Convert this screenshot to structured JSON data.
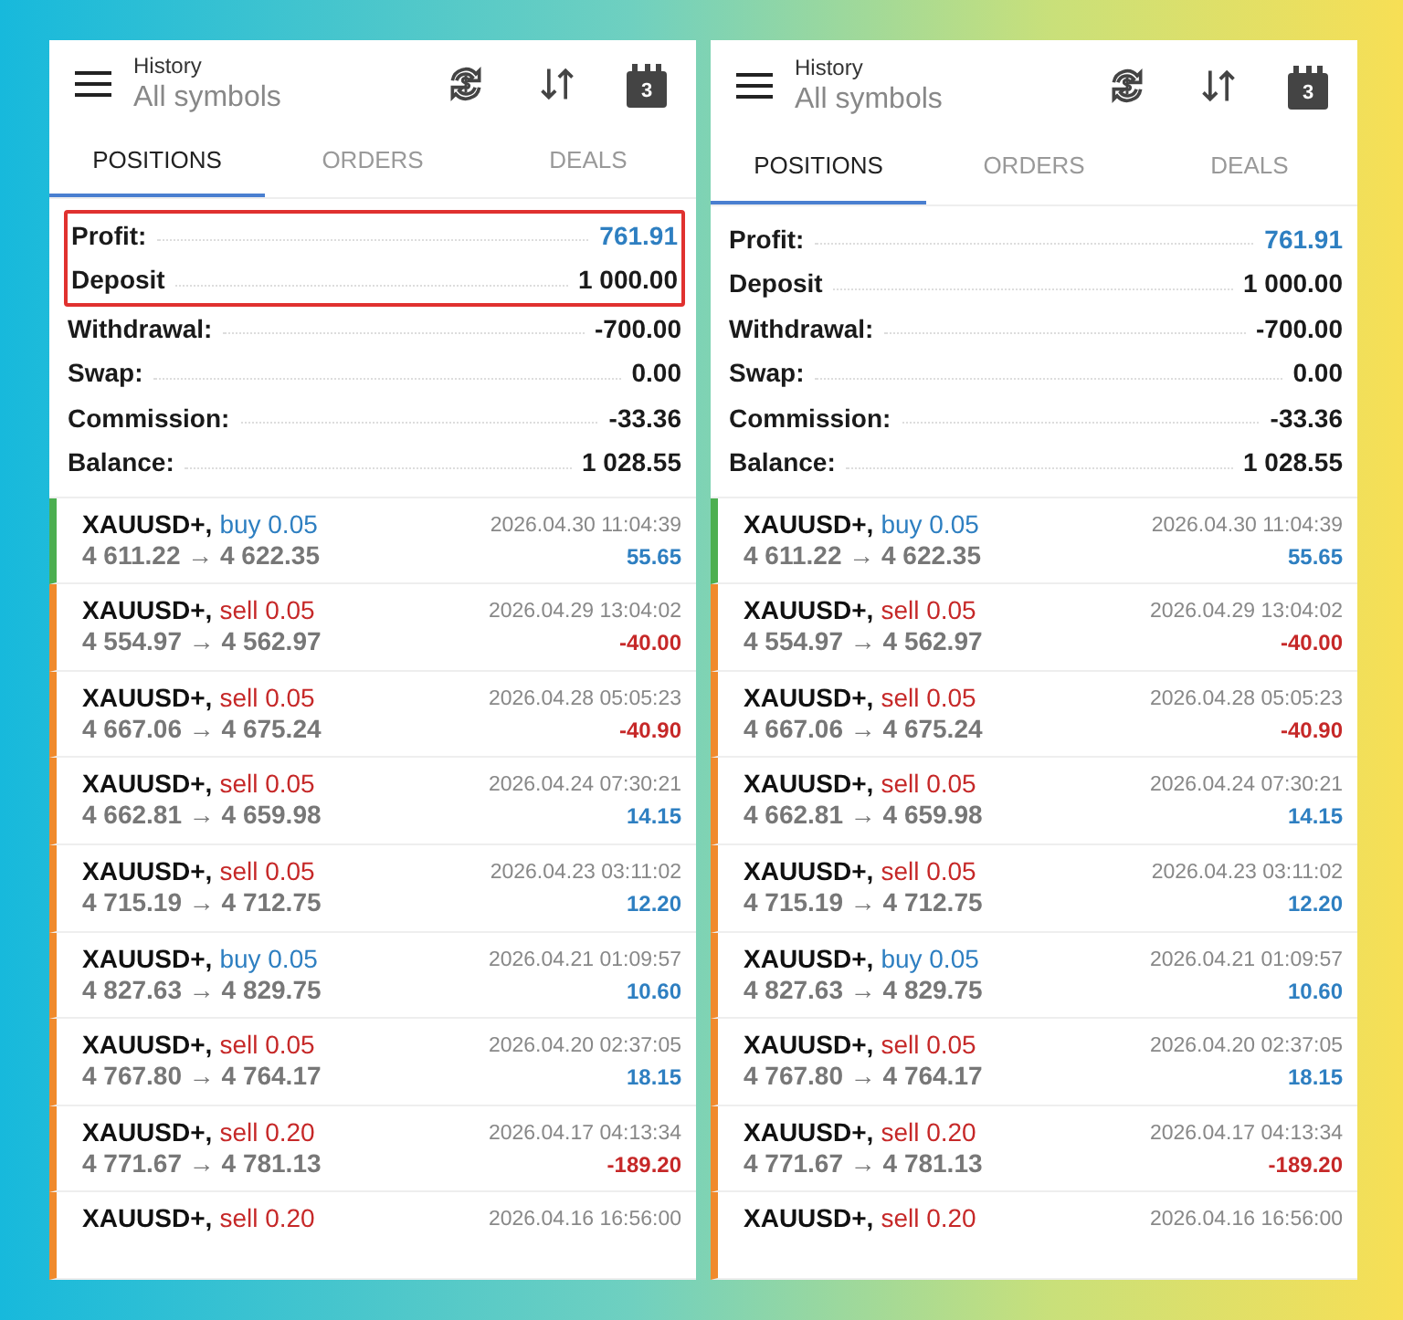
{
  "panels": [
    {
      "header": {
        "title": "History",
        "subtitle": "All symbols",
        "calendar_day": "3"
      },
      "tabs": [
        {
          "label": "POSITIONS",
          "selected": true
        },
        {
          "label": "ORDERS",
          "selected": false
        },
        {
          "label": "DEALS",
          "selected": false
        }
      ],
      "summary": [
        {
          "label": "Profit:",
          "value": "761.91",
          "color": "#2e7fc1",
          "highlighted": true
        },
        {
          "label": "Deposit",
          "value": "1 000.00",
          "color": "#1a1a1a",
          "highlighted": true
        },
        {
          "label": "Withdrawal:",
          "value": "-700.00",
          "color": "#1a1a1a",
          "highlighted": false
        },
        {
          "label": "Swap:",
          "value": "0.00",
          "color": "#1a1a1a",
          "highlighted": false
        },
        {
          "label": "Commission:",
          "value": "-33.36",
          "color": "#1a1a1a",
          "highlighted": false
        },
        {
          "label": "Balance:",
          "value": "1 028.55",
          "color": "#1a1a1a",
          "highlighted": false
        }
      ],
      "deals": [
        {
          "symbol": "XAUUSD+,",
          "side": {
            "text": "buy 0.05",
            "kind": "buy"
          },
          "color": "#4caf50",
          "prices": "4 611.22 → 4 622.35",
          "time": "2026.04.30 11:04:39",
          "profit": {
            "text": "55.65",
            "kind": "gain"
          }
        },
        {
          "symbol": "XAUUSD+,",
          "side": {
            "text": "sell 0.05",
            "kind": "sell"
          },
          "color": "#f08a2c",
          "prices": "4 554.97 → 4 562.97",
          "time": "2026.04.29 13:04:02",
          "profit": {
            "text": "-40.00",
            "kind": "loss"
          }
        },
        {
          "symbol": "XAUUSD+,",
          "side": {
            "text": "sell 0.05",
            "kind": "sell"
          },
          "color": "#f08a2c",
          "prices": "4 667.06 → 4 675.24",
          "time": "2026.04.28 05:05:23",
          "profit": {
            "text": "-40.90",
            "kind": "loss"
          }
        },
        {
          "symbol": "XAUUSD+,",
          "side": {
            "text": "sell 0.05",
            "kind": "sell"
          },
          "color": "#f08a2c",
          "prices": "4 662.81 → 4 659.98",
          "time": "2026.04.24 07:30:21",
          "profit": {
            "text": "14.15",
            "kind": "gain"
          }
        },
        {
          "symbol": "XAUUSD+,",
          "side": {
            "text": "sell 0.05",
            "kind": "sell"
          },
          "color": "#f08a2c",
          "prices": "4 715.19 → 4 712.75",
          "time": "2026.04.23 03:11:02",
          "profit": {
            "text": "12.20",
            "kind": "gain"
          }
        },
        {
          "symbol": "XAUUSD+,",
          "side": {
            "text": "buy 0.05",
            "kind": "buy"
          },
          "color": "#f08a2c",
          "prices": "4 827.63 → 4 829.75",
          "time": "2026.04.21 01:09:57",
          "profit": {
            "text": "10.60",
            "kind": "gain"
          }
        },
        {
          "symbol": "XAUUSD+,",
          "side": {
            "text": "sell 0.05",
            "kind": "sell"
          },
          "color": "#f08a2c",
          "prices": "4 767.80 → 4 764.17",
          "time": "2026.04.20 02:37:05",
          "profit": {
            "text": "18.15",
            "kind": "gain"
          }
        },
        {
          "symbol": "XAUUSD+,",
          "side": {
            "text": "sell 0.20",
            "kind": "sell"
          },
          "color": "#f08a2c",
          "prices": "4 771.67 → 4 781.13",
          "time": "2026.04.17 04:13:34",
          "profit": {
            "text": "-189.20",
            "kind": "loss"
          }
        },
        {
          "symbol": "XAUUSD+,",
          "side": {
            "text": "sell 0.20",
            "kind": "sell"
          },
          "color": "#f08a2c",
          "time": "2026.04.16 16:56:00"
        }
      ]
    },
    {
      "header": {
        "title": "History",
        "subtitle": "All symbols",
        "calendar_day": "3"
      },
      "tabs": [
        {
          "label": "POSITIONS",
          "selected": true
        },
        {
          "label": "ORDERS",
          "selected": false
        },
        {
          "label": "DEALS",
          "selected": false
        }
      ],
      "summary": [
        {
          "label": "Profit:",
          "value": "761.91",
          "color": "#2e7fc1",
          "highlighted": false
        },
        {
          "label": "Deposit",
          "value": "1 000.00",
          "color": "#1a1a1a",
          "highlighted": false
        },
        {
          "label": "Withdrawal:",
          "value": "-700.00",
          "color": "#1a1a1a",
          "highlighted": false
        },
        {
          "label": "Swap:",
          "value": "0.00",
          "color": "#1a1a1a",
          "highlighted": false
        },
        {
          "label": "Commission:",
          "value": "-33.36",
          "color": "#1a1a1a",
          "highlighted": false
        },
        {
          "label": "Balance:",
          "value": "1 028.55",
          "color": "#1a1a1a",
          "highlighted": false
        }
      ],
      "deals": [
        {
          "symbol": "XAUUSD+,",
          "side": {
            "text": "buy 0.05",
            "kind": "buy"
          },
          "color": "#4caf50",
          "prices": "4 611.22 → 4 622.35",
          "time": "2026.04.30 11:04:39",
          "profit": {
            "text": "55.65",
            "kind": "gain"
          }
        },
        {
          "symbol": "XAUUSD+,",
          "side": {
            "text": "sell 0.05",
            "kind": "sell"
          },
          "color": "#f08a2c",
          "prices": "4 554.97 → 4 562.97",
          "time": "2026.04.29 13:04:02",
          "profit": {
            "text": "-40.00",
            "kind": "loss"
          }
        },
        {
          "symbol": "XAUUSD+,",
          "side": {
            "text": "sell 0.05",
            "kind": "sell"
          },
          "color": "#f08a2c",
          "prices": "4 667.06 → 4 675.24",
          "time": "2026.04.28 05:05:23",
          "profit": {
            "text": "-40.90",
            "kind": "loss"
          }
        },
        {
          "symbol": "XAUUSD+,",
          "side": {
            "text": "sell 0.05",
            "kind": "sell"
          },
          "color": "#f08a2c",
          "prices": "4 662.81 → 4 659.98",
          "time": "2026.04.24 07:30:21",
          "profit": {
            "text": "14.15",
            "kind": "gain"
          }
        },
        {
          "symbol": "XAUUSD+,",
          "side": {
            "text": "sell 0.05",
            "kind": "sell"
          },
          "color": "#f08a2c",
          "prices": "4 715.19 → 4 712.75",
          "time": "2026.04.23 03:11:02",
          "profit": {
            "text": "12.20",
            "kind": "gain"
          }
        },
        {
          "symbol": "XAUUSD+,",
          "side": {
            "text": "buy 0.05",
            "kind": "buy"
          },
          "color": "#f08a2c",
          "prices": "4 827.63 → 4 829.75",
          "time": "2026.04.21 01:09:57",
          "profit": {
            "text": "10.60",
            "kind": "gain"
          }
        },
        {
          "symbol": "XAUUSD+,",
          "side": {
            "text": "sell 0.05",
            "kind": "sell"
          },
          "color": "#f08a2c",
          "prices": "4 767.80 → 4 764.17",
          "time": "2026.04.20 02:37:05",
          "profit": {
            "text": "18.15",
            "kind": "gain"
          }
        },
        {
          "symbol": "XAUUSD+,",
          "side": {
            "text": "sell 0.20",
            "kind": "sell"
          },
          "color": "#f08a2c",
          "prices": "4 771.67 → 4 781.13",
          "time": "2026.04.17 04:13:34",
          "profit": {
            "text": "-189.20",
            "kind": "loss"
          }
        },
        {
          "symbol": "XAUUSD+,",
          "side": {
            "text": "sell 0.20",
            "kind": "sell"
          },
          "color": "#f08a2c",
          "time": "2026.04.16 16:56:00"
        }
      ]
    }
  ]
}
